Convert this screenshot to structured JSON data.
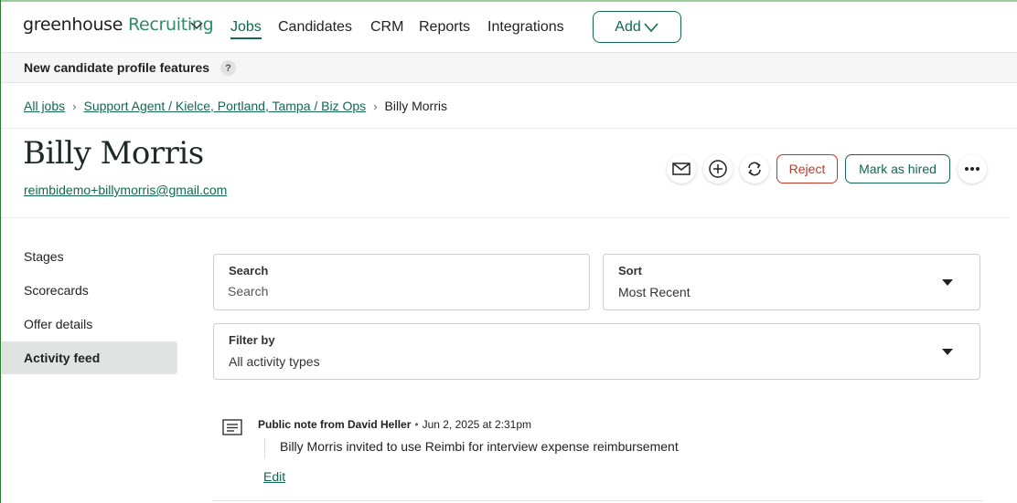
{
  "brand": {
    "name": "greenhouse",
    "product": "Recruiting"
  },
  "nav": {
    "items": [
      {
        "label": "Jobs",
        "active": true
      },
      {
        "label": "Candidates"
      },
      {
        "label": "CRM"
      },
      {
        "label": "Reports"
      },
      {
        "label": "Integrations"
      }
    ],
    "add_label": "Add"
  },
  "banner": {
    "text": "New candidate profile features",
    "help": "?"
  },
  "breadcrumb": {
    "all_jobs": "All jobs",
    "job": "Support Agent / Kielce, Portland, Tampa / Biz Ops",
    "current": "Billy Morris"
  },
  "candidate": {
    "name": "Billy Morris",
    "email": "reimbidemo+billymorris@gmail.com"
  },
  "actions": {
    "email_icon": "envelope-icon",
    "add_icon": "plus-circle-icon",
    "transfer_icon": "refresh-icon",
    "reject_label": "Reject",
    "hired_label": "Mark as hired",
    "more_icon": "ellipsis-icon"
  },
  "sidebar": {
    "items": [
      {
        "label": "Stages"
      },
      {
        "label": "Scorecards"
      },
      {
        "label": "Offer details"
      },
      {
        "label": "Activity feed",
        "active": true
      }
    ]
  },
  "filters": {
    "search": {
      "label": "Search",
      "placeholder": "Search"
    },
    "sort": {
      "label": "Sort",
      "value": "Most Recent"
    },
    "filter": {
      "label": "Filter by",
      "value": "All activity types"
    }
  },
  "activity": [
    {
      "author_line": "Public note from David Heller",
      "timestamp": "Jun 2, 2025 at 2:31pm",
      "body": "Billy Morris invited to use Reimbi for interview expense reimbursement",
      "edit_label": "Edit"
    }
  ],
  "colors": {
    "brand_green": "#11694f",
    "reject_red": "#c0392b",
    "active_bg": "#dfe3e1"
  }
}
